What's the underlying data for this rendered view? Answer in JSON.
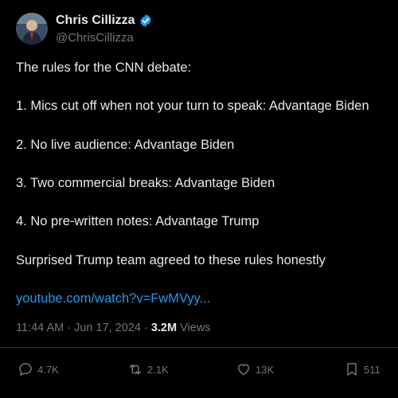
{
  "author": {
    "name": "Chris Cillizza",
    "handle": "@ChrisCillizza"
  },
  "tweet": {
    "lines": [
      "The rules for the CNN debate:",
      "1. Mics cut off when not your turn to speak: Advantage Biden",
      "2. No live audience: Advantage Biden",
      "3. Two commercial breaks: Advantage Biden",
      "4. No pre-written notes: Advantage Trump",
      "Surprised Trump team agreed to these rules honestly"
    ],
    "link": "youtube.com/watch?v=FwMVyy..."
  },
  "meta": {
    "time": "11:44 AM",
    "date": "Jun 17, 2024",
    "views_count": "3.2M",
    "views_label": "Views"
  },
  "actions": {
    "replies": "4.7K",
    "reposts": "2.1K",
    "likes": "13K",
    "bookmarks": "511"
  },
  "colors": {
    "background": "#000000",
    "text": "#e7e9ea",
    "muted": "#71767b",
    "link": "#1d9bf0",
    "verified": "#1d9bf0"
  }
}
